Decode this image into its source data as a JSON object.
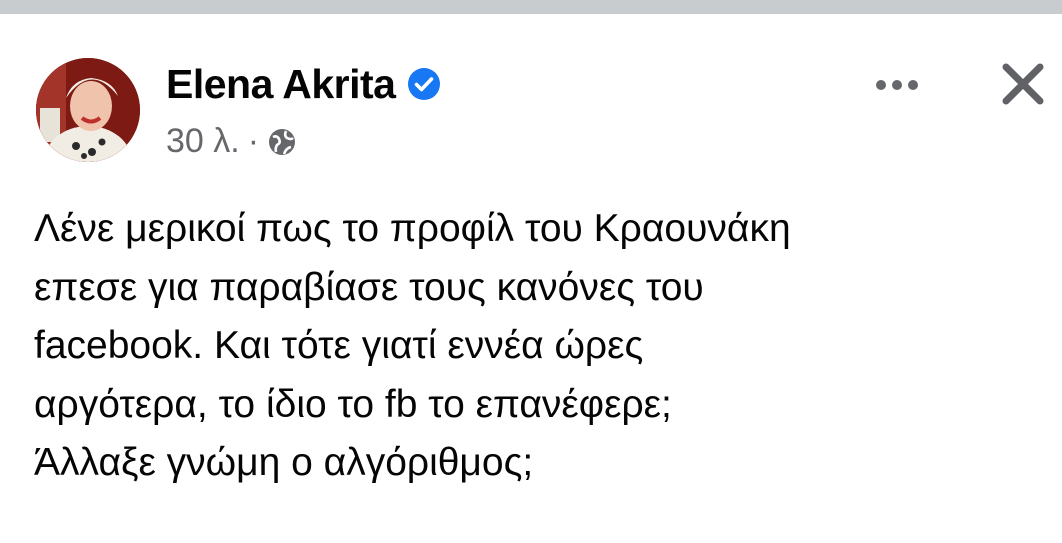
{
  "post": {
    "author": "Elena Akrita",
    "time": "30 λ.",
    "separator": "·",
    "audience_icon": "globe-icon",
    "verified_icon": "verified-badge-icon",
    "lines": [
      "Λένε μερικοί πως το προφίλ του Κραουνάκη",
      "επεσε για παραβίασε τους κανόνες του",
      "facebook. Και τότε γιατί εννέα ώρες",
      "αργότερα, το ίδιο το fb το επανέφερε;",
      "Άλλαξε γνώμη ο αλγόριθμος;"
    ]
  },
  "toolbar": {
    "more_icon": "more-horizontal-icon",
    "close_icon": "close-icon"
  },
  "colors": {
    "text": "#050505",
    "secondary": "#65676b",
    "verified": "#1877f2",
    "top_strip": "#c9cccf"
  }
}
